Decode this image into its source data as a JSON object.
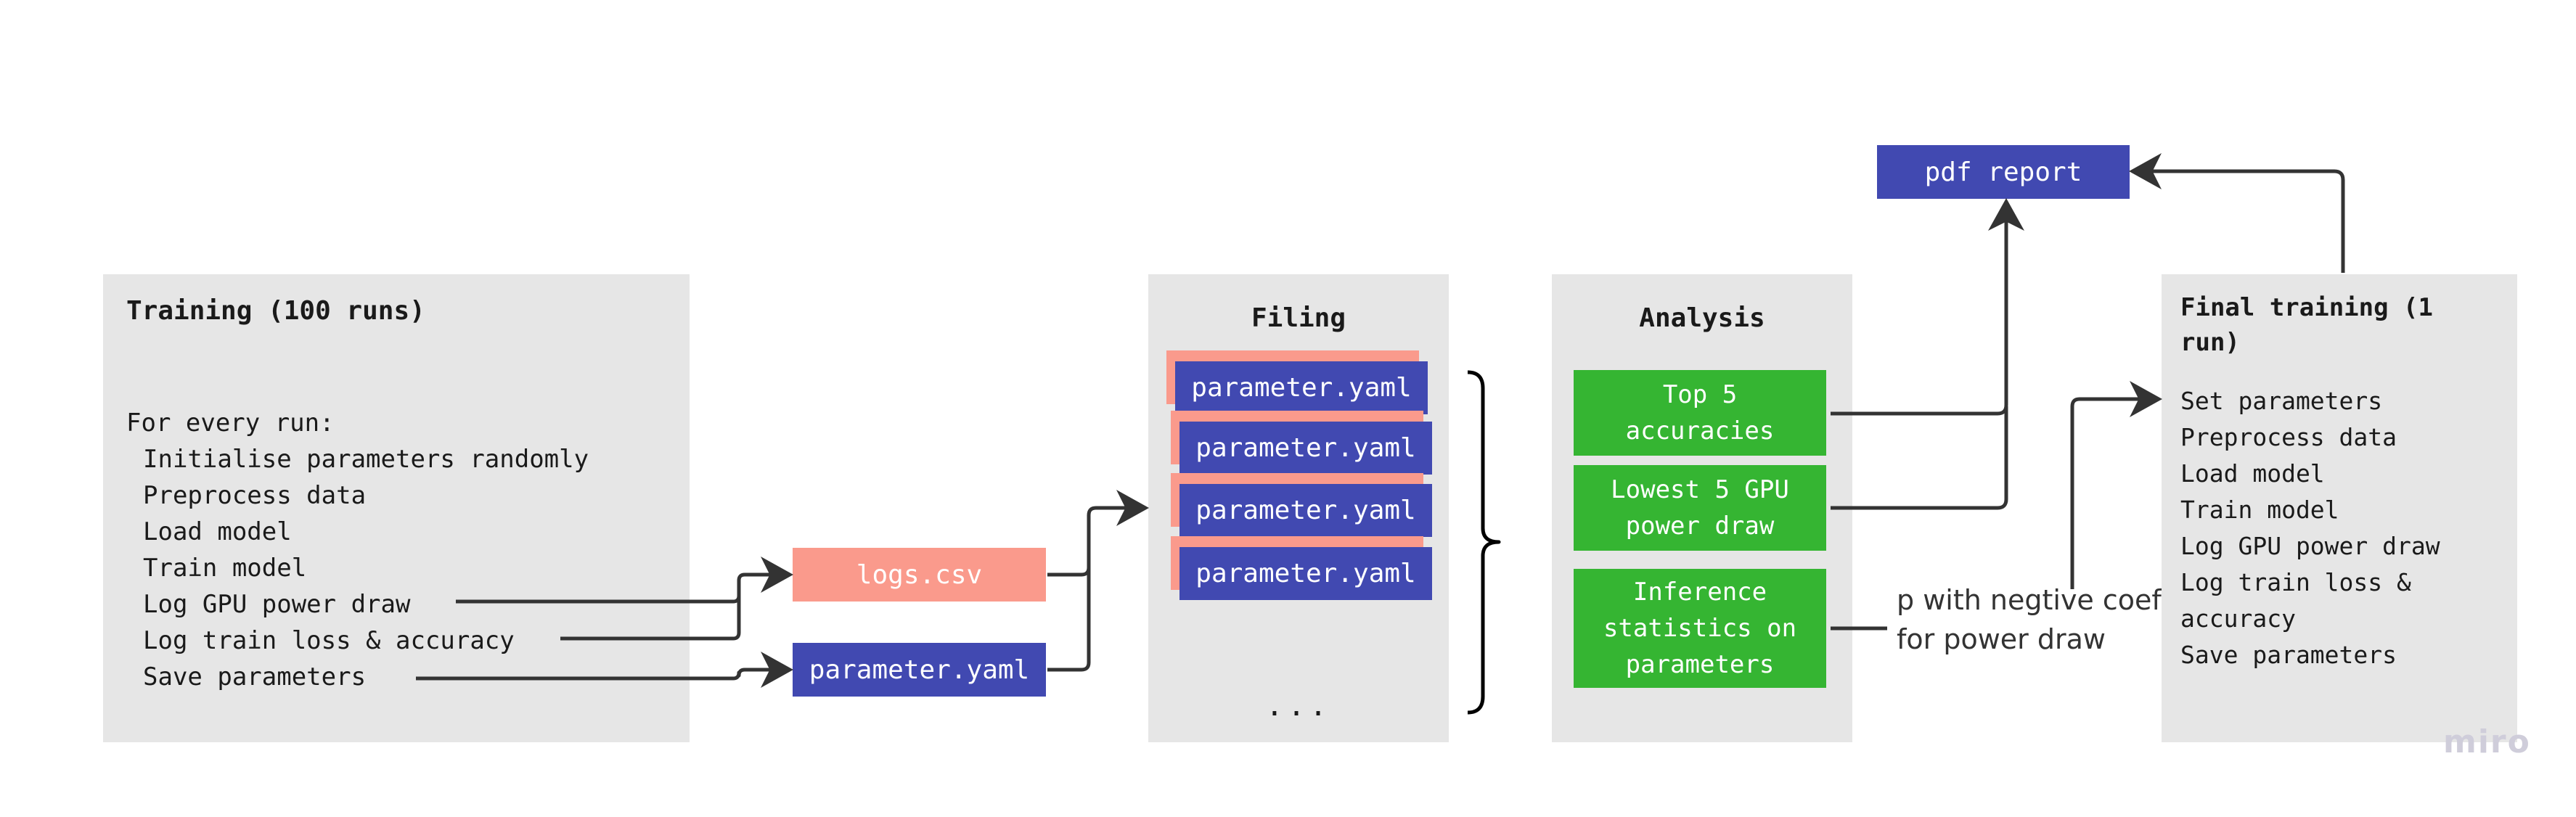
{
  "colors": {
    "panel_bg": "#e6e6e6",
    "file_blue": "#4149b1",
    "file_salmon": "#fa9a8c",
    "analysis_green": "#35b532",
    "connector": "#333333",
    "watermark": "#cfcdda"
  },
  "training": {
    "title": "Training (100 runs)",
    "intro": "For every run:",
    "steps": [
      "Initialise parameters randomly",
      "Preprocess data",
      "Load model",
      "Train model",
      "Log GPU power draw",
      "Log train loss & accuracy",
      "Save parameters"
    ]
  },
  "outputs": {
    "logs_file": "logs.csv",
    "params_file": "parameter.yaml"
  },
  "filing": {
    "title": "Filing",
    "files": [
      "parameter.yaml",
      "parameter.yaml",
      "parameter.yaml",
      "parameter.yaml"
    ],
    "more": "..."
  },
  "analysis": {
    "title": "Analysis",
    "items": [
      "Top 5\naccuracies",
      "Lowest 5 GPU\npower draw",
      "Inference\nstatistics on\nparameters"
    ]
  },
  "annotation": {
    "lines": [
      "p with negtive coef",
      "for power draw"
    ]
  },
  "report": {
    "label": "pdf report"
  },
  "final_training": {
    "title": "Final training (1\nrun)",
    "steps": [
      "Set parameters",
      "Preprocess data",
      "Load model",
      "Train model",
      "Log GPU power draw",
      "Log train loss &",
      "accuracy",
      "Save parameters"
    ]
  },
  "watermark": "miro"
}
